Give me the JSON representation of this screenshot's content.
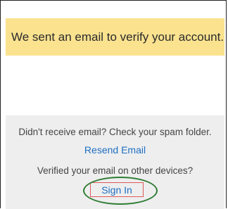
{
  "banner": {
    "text": "We sent an email to verify your account."
  },
  "panel": {
    "spam_hint": "Didn't receive email? Check your spam folder.",
    "resend_label": "Resend Email",
    "other_devices_prompt": "Verified your email on other devices?",
    "signin_label": "Sign In"
  },
  "colors": {
    "banner_bg": "#fae28f",
    "panel_bg": "#eeeeef",
    "link": "#1f6fc0",
    "highlight_red": "#e05a5a",
    "highlight_green": "#2e7d32"
  }
}
